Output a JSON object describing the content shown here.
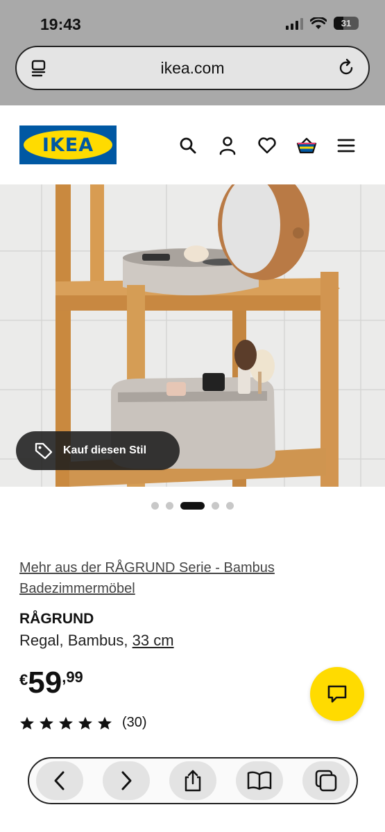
{
  "status_bar": {
    "time": "19:43",
    "battery": "31"
  },
  "browser": {
    "url": "ikea.com"
  },
  "header": {
    "logo_text": "IKEA",
    "icons": [
      "search-icon",
      "account-icon",
      "heart-icon",
      "basket-icon",
      "menu-icon"
    ]
  },
  "hero": {
    "style_button_label": "Kauf diesen Stil",
    "image_count": 5,
    "active_index": 2
  },
  "product": {
    "series_link": "Mehr aus der RÅGRUND Serie - Bambus Badezimmermöbel",
    "name": "RÅGRUND",
    "description_prefix": "Regal, Bambus, ",
    "size": "33 cm",
    "price_currency": "€",
    "price_integer": "59",
    "price_decimal": ",99",
    "rating": 5,
    "review_count": "(30)"
  },
  "colors": {
    "brand_blue": "#0058a3",
    "brand_yellow": "#ffdb00"
  }
}
